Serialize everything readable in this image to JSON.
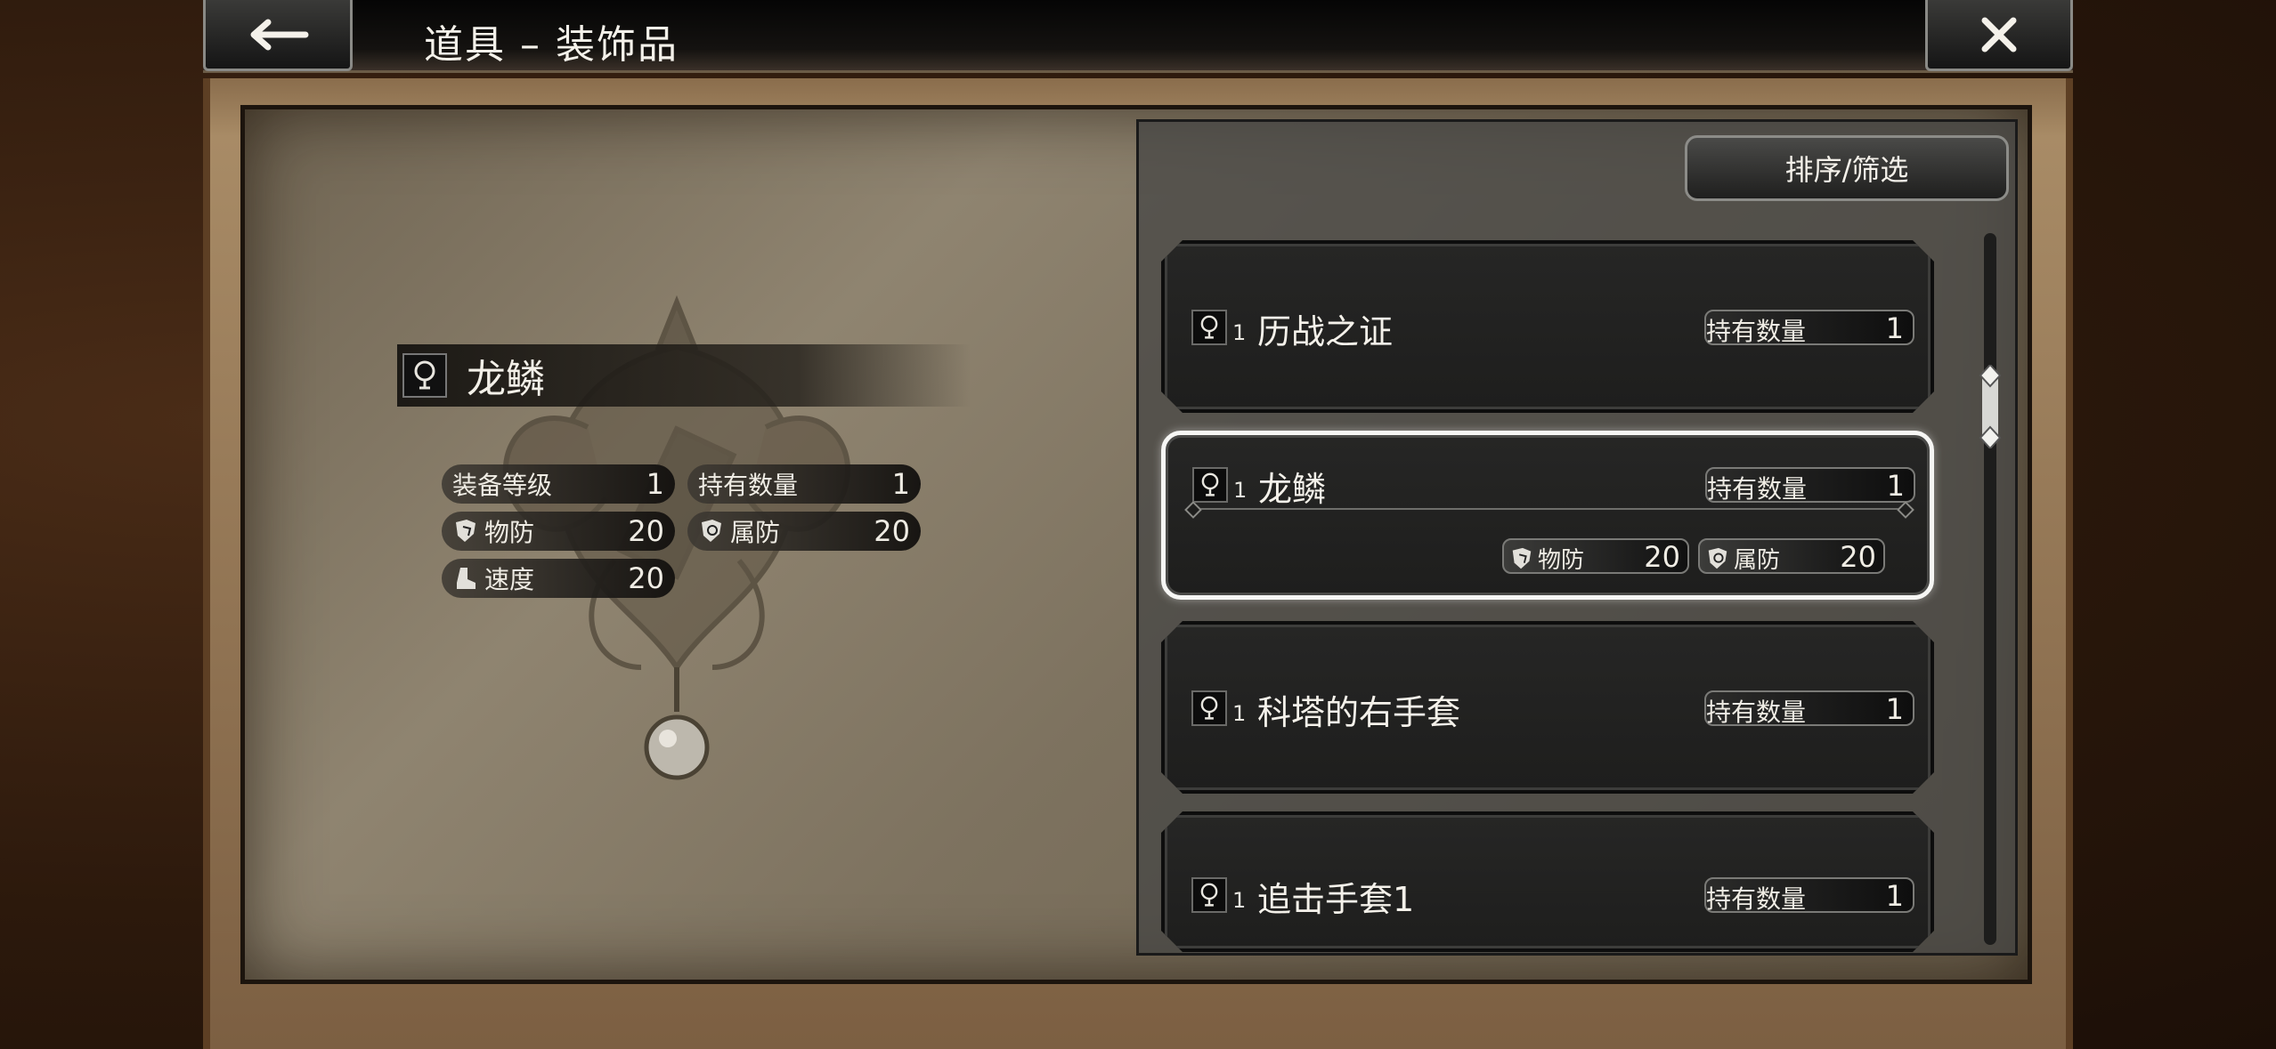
{
  "header": {
    "title": "道具 – 装饰品",
    "back_icon": "back-arrow-icon",
    "close_icon": "close-icon"
  },
  "detail": {
    "name": "龙鳞",
    "stats": {
      "equip_level_label": "装备等级",
      "equip_level_value": "1",
      "owned_label": "持有数量",
      "owned_value": "1",
      "phys_def_label": "物防",
      "phys_def_value": "20",
      "elem_def_label": "属防",
      "elem_def_value": "20",
      "speed_label": "速度",
      "speed_value": "20"
    }
  },
  "list": {
    "sort_label": "排序/筛选",
    "items": [
      {
        "rank": "1",
        "name": "历战之证",
        "qty_label": "持有数量",
        "qty": "1"
      },
      {
        "rank": "1",
        "name": "龙鳞",
        "qty_label": "持有数量",
        "qty": "1",
        "phys_def_label": "物防",
        "phys_def": "20",
        "elem_def_label": "属防",
        "elem_def": "20"
      },
      {
        "rank": "1",
        "name": "科塔的右手套",
        "qty_label": "持有数量",
        "qty": "1"
      },
      {
        "rank": "1",
        "name": "追击手套1",
        "qty_label": "持有数量",
        "qty": "1"
      }
    ]
  },
  "colors": {
    "text": "#f4f1ea",
    "selected_border": "#f6f6f4",
    "parchment": "#8f8470"
  }
}
